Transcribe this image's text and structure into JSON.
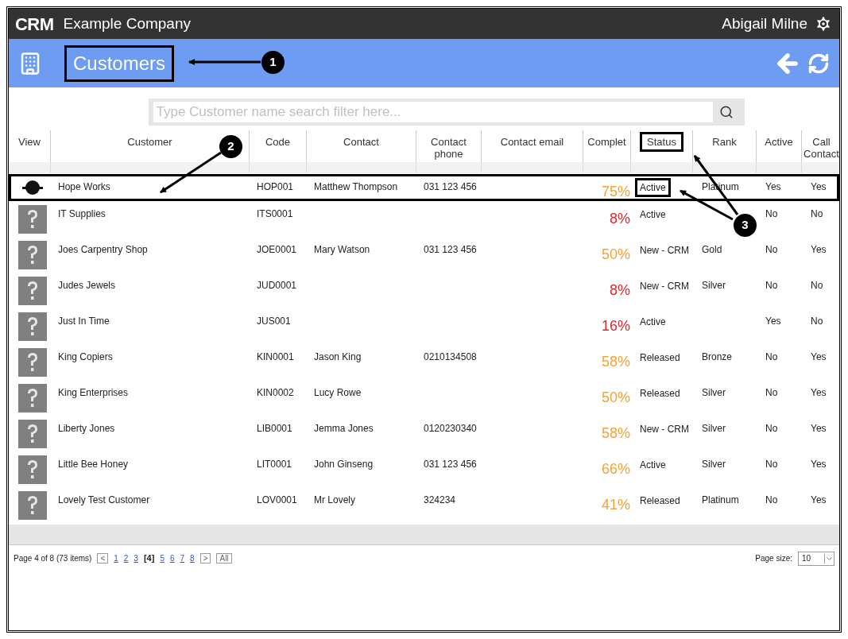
{
  "topbar": {
    "logo": "CRM",
    "company": "Example Company",
    "user": "Abigail Milne"
  },
  "header": {
    "title": "Customers",
    "title_boxed": true
  },
  "search": {
    "placeholder": "Type Customer name search filter here..."
  },
  "columns": [
    {
      "label": "View",
      "boxed": false
    },
    {
      "label": "Customer",
      "boxed": false
    },
    {
      "label": "Code",
      "boxed": false
    },
    {
      "label": "Contact",
      "boxed": false
    },
    {
      "label": "Contact phone",
      "boxed": false
    },
    {
      "label": "Contact email",
      "boxed": false
    },
    {
      "label": "Complet",
      "boxed": false
    },
    {
      "label": "Status",
      "boxed": true
    },
    {
      "label": "Rank",
      "boxed": false
    },
    {
      "label": "Active",
      "boxed": false
    },
    {
      "label": "Call Contact",
      "boxed": false
    }
  ],
  "rows": [
    {
      "kind": "logo",
      "customer": "Hope Works",
      "code": "HOP001",
      "contact": "Matthew Thompson",
      "phone": "031 123 456",
      "complete": "75%",
      "color": "#f7a033",
      "status": "Active",
      "rank": "Platinum",
      "active": "Yes",
      "call": "Yes",
      "boxed": true,
      "status_boxed": true
    },
    {
      "kind": "placeholder",
      "customer": "IT Supplies",
      "code": "ITS0001",
      "complete": "8%",
      "color": "#e0262b",
      "status": "Active",
      "active": "No",
      "call": "No",
      "boxed": false,
      "status_boxed": false
    },
    {
      "kind": "placeholder",
      "customer": "Joes Carpentry Shop",
      "code": "JOE0001",
      "contact": "Mary Watson",
      "phone": "031 123 456",
      "complete": "50%",
      "color": "#f7a033",
      "status": "New - CRM",
      "rank": "Gold",
      "active": "No",
      "call": "Yes",
      "boxed": false,
      "status_boxed": false
    },
    {
      "kind": "placeholder",
      "customer": "Judes Jewels",
      "code": "JUD0001",
      "complete": "8%",
      "color": "#e0262b",
      "status": "New - CRM",
      "rank": "Silver",
      "active": "No",
      "call": "No",
      "boxed": false,
      "status_boxed": false
    },
    {
      "kind": "placeholder",
      "customer": "Just In Time",
      "code": "JUS001",
      "complete": "16%",
      "color": "#e0262b",
      "status": "Active",
      "active": "Yes",
      "call": "No",
      "boxed": false,
      "status_boxed": false
    },
    {
      "kind": "placeholder",
      "customer": "King Copiers",
      "code": "KIN0001",
      "contact": "Jason King",
      "phone": "0210134508",
      "complete": "58%",
      "color": "#f7a033",
      "status": "Released",
      "rank": "Bronze",
      "active": "No",
      "call": "Yes",
      "boxed": false,
      "status_boxed": false
    },
    {
      "kind": "placeholder",
      "customer": "King Enterprises",
      "code": "KIN0002",
      "contact": "Lucy Rowe",
      "complete": "50%",
      "color": "#f7a033",
      "status": "Released",
      "rank": "Silver",
      "active": "No",
      "call": "Yes",
      "boxed": false,
      "status_boxed": false
    },
    {
      "kind": "placeholder",
      "customer": "Liberty Jones",
      "code": "LIB0001",
      "contact": "Jemma Jones",
      "phone": "0120230340",
      "complete": "58%",
      "color": "#f7a033",
      "status": "New - CRM",
      "rank": "Silver",
      "active": "No",
      "call": "Yes",
      "boxed": false,
      "status_boxed": false
    },
    {
      "kind": "placeholder",
      "customer": "Little Bee Honey",
      "code": "LIT0001",
      "contact": "John Ginseng",
      "phone": "031 123 456",
      "complete": "66%",
      "color": "#f7a033",
      "status": "Active",
      "rank": "Silver",
      "active": "No",
      "call": "Yes",
      "boxed": false,
      "status_boxed": false
    },
    {
      "kind": "placeholder",
      "customer": "Lovely Test Customer",
      "code": "LOV0001",
      "contact": "Mr Lovely",
      "phone": "324234",
      "complete": "41%",
      "color": "#f7a033",
      "status": "Released",
      "rank": "Platinum",
      "active": "No",
      "call": "Yes",
      "boxed": false,
      "status_boxed": false
    }
  ],
  "pager": {
    "summary": "Page 4 of 8 (73 items)",
    "prev": "<",
    "next": ">",
    "all": "All",
    "pages": [
      {
        "label": "1",
        "selected": false
      },
      {
        "label": "2",
        "selected": false
      },
      {
        "label": "3",
        "selected": false
      },
      {
        "label": "[4]",
        "selected": true
      },
      {
        "label": "5",
        "selected": false
      },
      {
        "label": "6",
        "selected": false
      },
      {
        "label": "7",
        "selected": false
      },
      {
        "label": "8",
        "selected": false
      }
    ],
    "page_size_label": "Page size:",
    "page_size": "10"
  },
  "annotations": [
    {
      "label": "1"
    },
    {
      "label": "2"
    },
    {
      "label": "3"
    }
  ]
}
